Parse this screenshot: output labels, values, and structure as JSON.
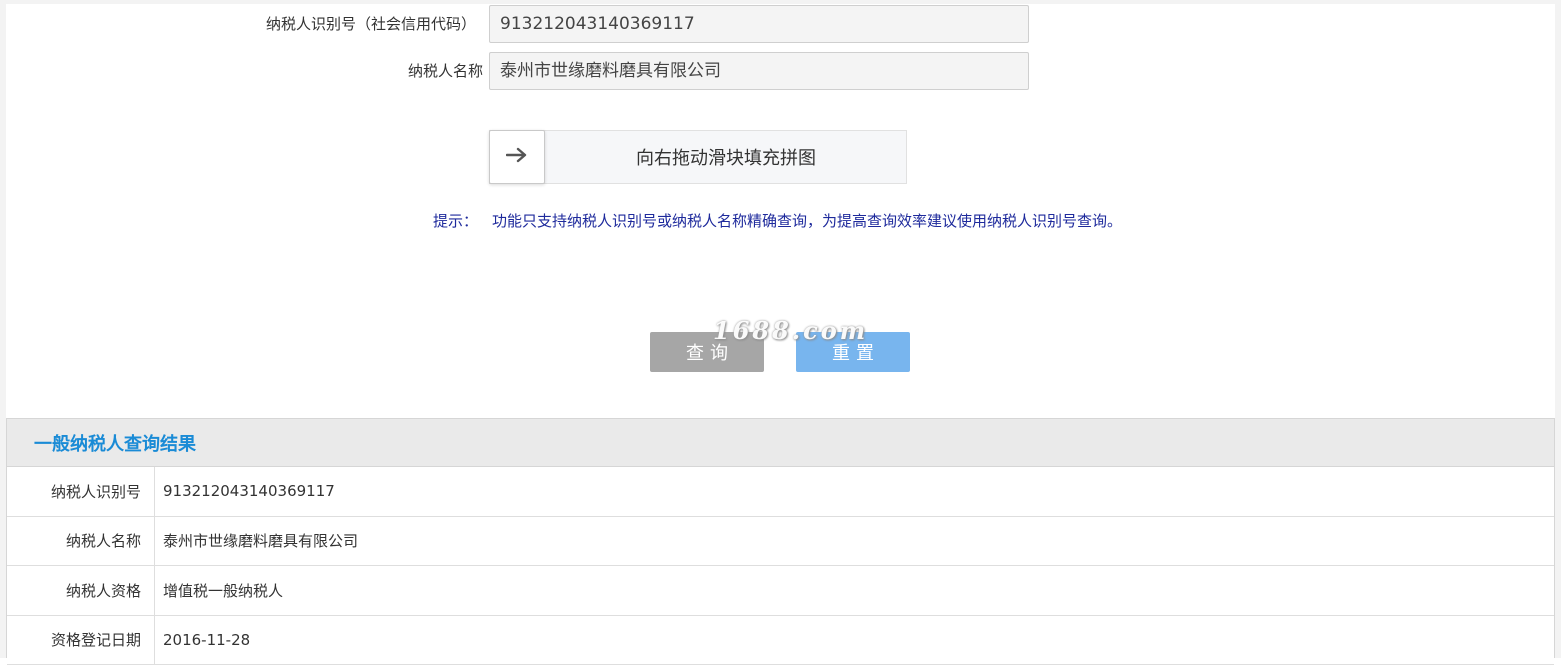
{
  "form": {
    "tax_id_label": "纳税人识别号（社会信用代码）",
    "tax_id_value": "913212043140369117",
    "name_label": "纳税人名称",
    "name_value": "泰州市世缘磨料磨具有限公司"
  },
  "captcha": {
    "handle_icon": "arrow-right-icon",
    "instruction": "向右拖动滑块填充拼图"
  },
  "tip": {
    "label": "提示：",
    "text": "功能只支持纳税人识别号或纳税人名称精确查询，为提高查询效率建议使用纳税人识别号查询。"
  },
  "watermark": "1688.com",
  "buttons": {
    "query": "查询",
    "reset": "重置"
  },
  "results": {
    "title": "一般纳税人查询结果",
    "rows": [
      {
        "key": "纳税人识别号",
        "value": "913212043140369117"
      },
      {
        "key": "纳税人名称",
        "value": "泰州市世缘磨料磨具有限公司"
      },
      {
        "key": "纳税人资格",
        "value": "增值税一般纳税人"
      },
      {
        "key": "资格登记日期",
        "value": "2016-11-28"
      }
    ]
  },
  "colors": {
    "tip_text": "#1e2a9c",
    "results_title": "#1a8bd6",
    "query_button": "#a6a6a6",
    "reset_button": "#78b5ee"
  }
}
